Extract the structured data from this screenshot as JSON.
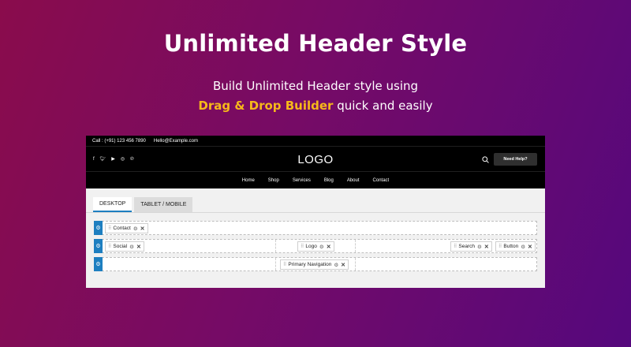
{
  "hero": {
    "title": "Unlimited Header Style",
    "line1": "Build Unlimited Header style using",
    "accent": "Drag & Drop Builder",
    "line2_rest": " quick and easily"
  },
  "preview": {
    "topbar": {
      "phone": "Call : (+91) 123 456 7890",
      "email": "Hello@Example.com"
    },
    "socials": [
      "facebook-icon",
      "twitter-icon",
      "youtube-icon",
      "instagram-icon",
      "pinterest-icon"
    ],
    "logo": "LOGO",
    "help_button": "Need Help?",
    "nav": [
      "Home",
      "Shop",
      "Services",
      "Blog",
      "About",
      "Contact"
    ]
  },
  "builder": {
    "tabs": [
      {
        "label": "DESKTOP",
        "active": true
      },
      {
        "label": "TABLET / MOBILE",
        "active": false
      }
    ],
    "rows": {
      "top": {
        "left": "Contact"
      },
      "main": {
        "left": "Social",
        "center": "Logo",
        "right1": "Search",
        "right2": "Button"
      },
      "bottom": {
        "center": "Primary Navigation"
      }
    }
  },
  "colors": {
    "accent": "#f6b81a",
    "builder_blue": "#1e7fc0"
  }
}
